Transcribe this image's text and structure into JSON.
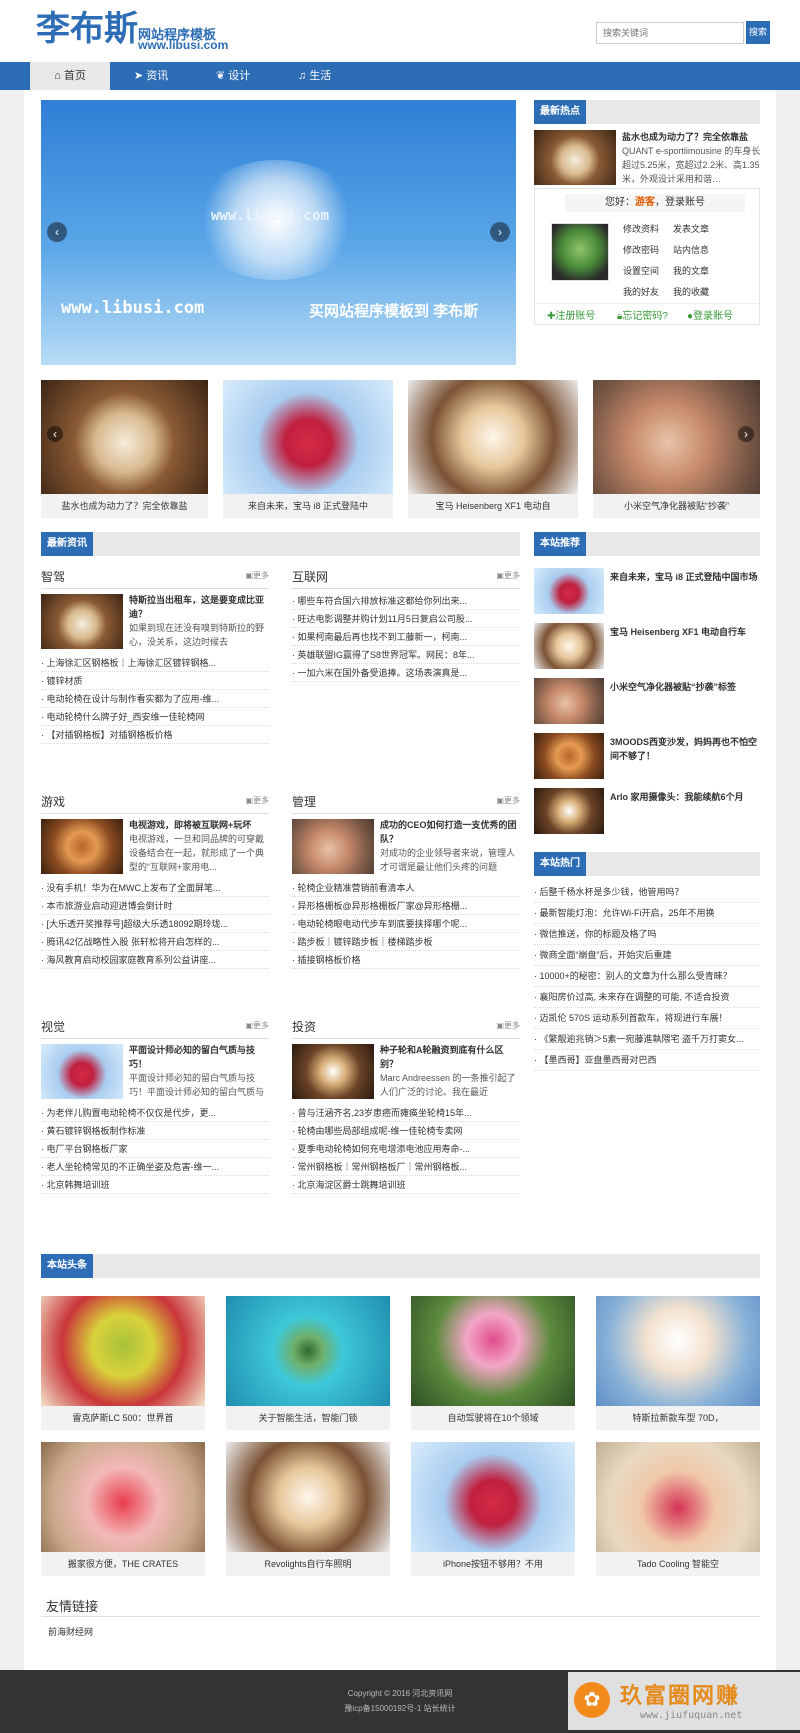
{
  "header": {
    "logo_text": "李布斯",
    "logo_sub1": "网站程序模板",
    "logo_sub2": "www.libusi.com",
    "search_placeholder": "搜索关键词",
    "search_button": "搜索"
  },
  "nav": {
    "items": [
      {
        "label": "首页",
        "icon": "home-icon"
      },
      {
        "label": "资讯",
        "icon": "send-icon"
      },
      {
        "label": "设计",
        "icon": "leaf-icon"
      },
      {
        "label": "生活",
        "icon": "music-icon"
      }
    ]
  },
  "banner": {
    "watermark": "www.libusi.com",
    "left_text": "www.libusi.com",
    "right_text": "买网站程序模板到 李布斯"
  },
  "hot_latest": {
    "title": "最新热点",
    "item": {
      "title": "盐水也成为动力了？完全依靠盐",
      "desc": "QUANT e-sportlimousine 的车身长超过5.25米，宽超过2.2米、高1.35米，外观设计采用和谐…"
    }
  },
  "user": {
    "greeting_prefix": "您好：",
    "guest": "游客",
    "greeting_suffix": "，登录账号",
    "links": [
      "修改资料",
      "发表文章",
      "修改密码",
      "站内信息",
      "设置空间",
      "我的文章",
      "我的好友",
      "我的收藏"
    ],
    "register": "注册账号",
    "forgot": "忘记密码?",
    "login": "登录账号"
  },
  "carousel": {
    "captions": [
      "盐水也成为动力了？完全依靠盐",
      "来自未来，宝马 i8 正式登陆中",
      "宝马 Heisenberg XF1 电动自",
      "小米空气净化器被贴“抄袭”"
    ]
  },
  "news": {
    "title": "最新资讯",
    "more": "更多",
    "blocks": [
      {
        "title": "智驾",
        "item_title": "特斯拉当出租车，这是要变成比亚迪？",
        "item_desc": "如果到现在还没有嗅到特斯拉的野心，没关系，这边时候去",
        "links": [
          "上海徐汇区钢格板｜上海徐汇区镀锌钢格...",
          "镀锌材质",
          "电动轮椅在设计与制作看实都为了应用-维...",
          "电动轮椅什么牌子好_西安维一佳轮椅网",
          "【对插钢格板】对插钢格板价格"
        ]
      },
      {
        "title": "互联网",
        "links": [
          "哪些车符合国六排放标准这都给你列出来...",
          "旺达电影调整并购计划11月5日复启公司股...",
          "如果柯南最后再也找不到工藤新一，柯南...",
          "英雄联盟IG赢得了S8世界冠军。网民：8年...",
          "一加六米在国外备受追捧。这场表演真是..."
        ]
      },
      {
        "title": "游戏",
        "item_title": "电视游戏，即将被互联网+玩坏",
        "item_desc": "电视游戏，一旦和同品牌的可穿戴设备结合在一起，就形成了一个典型的“互联网+家用电...",
        "links": [
          "没有手机！华为在MWC上发布了全面屏笔...",
          "本市旅游业启动迎进博会倒计时",
          "[大乐透开奖推荐号]超级大乐透18092期玲珑...",
          "腾讯42亿战略性入股 张轩松将开启怎样的...",
          "海风教育启动校园家庭教育系列公益讲座..."
        ]
      },
      {
        "title": "管理",
        "item_title": "成功的CEO如何打造一支优秀的团队？",
        "item_desc": "对成功的企业领导者来说，管理人才可谓是最让他们头疼的问题",
        "links": [
          "轮椅企业精准营销前看清本人",
          "异形格栅板@异形格栅板厂家@异形格栅...",
          "电动轮椅眼电动代步车到底要挟择哪个呢...",
          "踏步板｜镀锌踏步板｜楼梯踏步板",
          "插接钢格板价格"
        ]
      },
      {
        "title": "视觉",
        "item_title": "平面设计师必知的留白气质与技巧！",
        "item_desc": "平面设计师必知的留白气质与技巧！平面设计师必知的留白气质与技巧！平",
        "links": [
          "为老伴儿购置电动轮椅不仅仅是代步，更...",
          "黄石镀锌钢格板制作标准",
          "电厂平台钢格板厂家",
          "老人坐轮椅常见的不正确坐姿及危害-维一...",
          "北京韩舞培训班"
        ]
      },
      {
        "title": "投资",
        "item_title": "种子轮和A轮融资到底有什么区别？",
        "item_desc": "Marc Andreessen 的一条推引起了人们广泛的讨论。我在最近",
        "links": [
          "曾与汪涵齐名,23岁患癌而瘫痪坐轮椅15年...",
          "轮椅由哪些局部组成呢-维一佳轮椅专卖网",
          "夏季电动轮椅如何充电增添电池应用寿命-...",
          "常州钢格板｜常州钢格板厂｜常州钢格板...",
          "北京海淀区爵士跳舞培训班"
        ]
      }
    ]
  },
  "recommend": {
    "title": "本站推荐",
    "items": [
      "来自未来，宝马 i8 正式登陆中国市场",
      "宝马 Heisenberg XF1 电动自行车",
      "小米空气净化器被贴“抄袭”标签",
      "3MOODS西变沙发，妈妈再也不怕空间不够了！",
      "Arlo 家用摄像头：我能续航6个月"
    ]
  },
  "popular": {
    "title": "本站热门",
    "items": [
      "后整千杨水杯是多少钱，他管用吗？",
      "最新智能灯泡：允许Wi-Fi开启，25年不用换",
      "微信推送，你的标题及格了吗",
      "微商全面“崩盘”后，开始灾后重建",
      "10000+的秘密：别人的文章为什么那么受青睐？",
      "襄阳房价过高, 未来存在调整的可能, 不适合投资",
      "迈凯伦 570S 运动系列首款车，将现进行车展！",
      "《繁靓逾兆销＞5素一宛藤進執隈宅 盗千万打窦女...",
      "【墨西哥】亚盘墨西哥对巴西"
    ]
  },
  "headlines": {
    "title": "本站头条",
    "captions": [
      "雷克萨斯LC 500：世界首",
      "关于智能生活，智能门锁",
      "自动驾驶将在10个领域",
      "特斯拉新款车型 70D，",
      "搬家很方便，THE CRATES",
      "Revolights自行车照明",
      "iPhone按钮不够用？不用",
      "Tado Cooling 智能空"
    ]
  },
  "links": {
    "title": "友情链接",
    "items": [
      "前海财经网"
    ]
  },
  "footer": {
    "line1": "Copyright © 2016 河北资讯网",
    "line2": "豫icp备15000192号-1 站长统计",
    "watermark_text": "玖富圈网赚",
    "watermark_url": "www.jiufuquan.net"
  },
  "colors": {
    "brand": "#2d6db5",
    "guest": "#e05a00",
    "green": "#3a9a3a"
  }
}
